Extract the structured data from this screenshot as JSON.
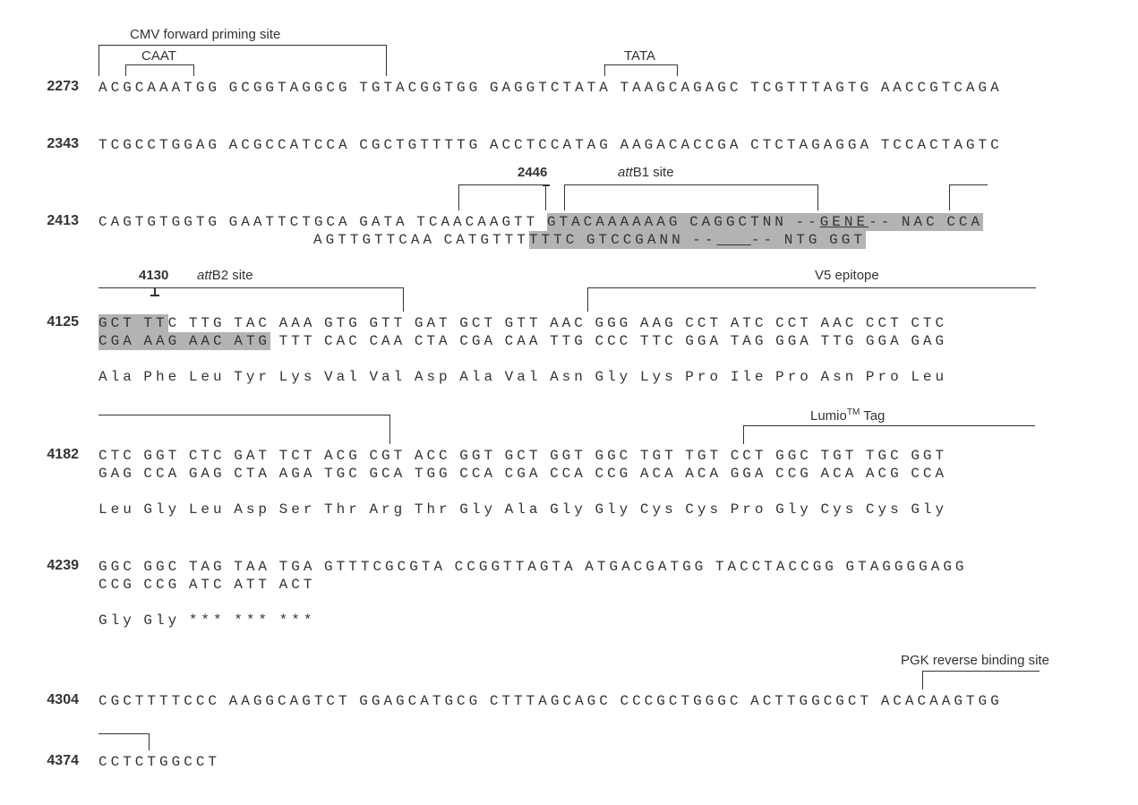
{
  "annotations": {
    "cmv": "CMV forward priming site",
    "caat": "CAAT",
    "tata": "TATA",
    "p2446": "2446",
    "p4130": "4130",
    "attb1": "attB1 site",
    "attb2": "attB2 site",
    "v5": "V5 epitope",
    "lumio_pre": "Lumio",
    "lumio_tm": "TM",
    "lumio_post": " Tag",
    "pgk": "PGK reverse binding site",
    "gene": "GENE",
    "pro": "Pro"
  },
  "rows": {
    "r1": {
      "pos": "2273",
      "s1": "ACGCAAATGG GCGGTAGGCG TGTACGGTGG GAGGTCTATA TAAGCAGAGC TCGTTTAGTG AACCGTCAGA"
    },
    "r2": {
      "pos": "2343",
      "s1": "TCGCCTGGAG ACGCCATCCA CGCTGTTTTG ACCTCCATAG AAGACACCGA CTCTAGAGGA TCCACTAGTC"
    },
    "r3": {
      "pos": "2413",
      "s1a": "CAGTGTGGTG GAATTCTGCA GATA TCAACAAGTT ",
      "hl1": "GTACAAAAAAG CAGGCTNN --",
      "gene": "GENE",
      "hl1b": "-- NAC CCA",
      "s2a": "                         AGTTGTTCAA CATGTTT",
      "hl2": "TTTC GTCCGANN --",
      "gene2": "    ",
      "hl2b": "-- NTG GGT"
    },
    "r4": {
      "pos": "4125",
      "hl_a": "GCT TT",
      "s1a": "C TTG TAC AAA GTG GTT GAT GCT GTT AAC GGG AAG CCT ATC CCT AAC CCT CTC",
      "hl_b": "CGA AAG AAC ATG",
      "s2a": " TTT CAC CAA CTA CGA CAA TTG CCC TTC GGA TAG GGA TTG GGA GAG",
      "aa": "Ala Phe Leu Tyr Lys Val Val Asp Ala Val Asn Gly Lys Pro Ile Pro Asn Pro Leu"
    },
    "r5": {
      "pos": "4182",
      "s1": "CTC GGT CTC GAT TCT ACG CGT ACC GGT GCT GGT GGC TGT TGT CCT GGC TGT TGC GGT",
      "s2": "GAG CCA GAG CTA AGA TGC GCA TGG CCA CGA CCA CCG ACA ACA GGA CCG ACA ACG CCA",
      "aa": "Leu Gly Leu Asp Ser Thr Arg Thr Gly Ala Gly Gly Cys Cys Pro Gly Cys Cys Gly"
    },
    "r6": {
      "pos": "4239",
      "s1": "GGC GGC TAG TAA TGA GTTTCGCGTA CCGGTTAGTA ATGACGATGG TACCTACCGG GTAGGGGAGG",
      "s2": "CCG CCG ATC ATT ACT",
      "aa": "Gly Gly *** *** ***"
    },
    "r7": {
      "pos": "4304",
      "s1": "CGCTTTTCCC AAGGCAGTCT GGAGCATGCG CTTTAGCAGC CCCGCTGGGC ACTTGGCGCT ACACAAGTGG"
    },
    "r8": {
      "pos": "4374",
      "s1": "CCTCTGGCCT"
    }
  }
}
